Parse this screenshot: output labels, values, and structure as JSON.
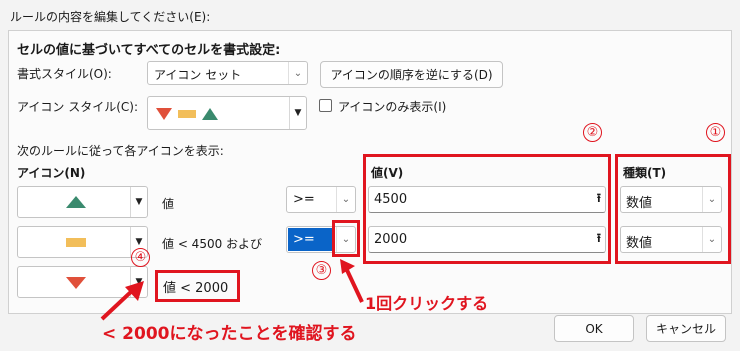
{
  "dialog": {
    "title": "ルールの内容を編集してください(E):"
  },
  "section": {
    "heading": "セルの値に基づいてすべてのセルを書式設定:"
  },
  "format_style": {
    "label": "書式スタイル(O):",
    "value": "アイコン セット"
  },
  "reverse_button": {
    "label": "アイコンの順序を逆にする(D)"
  },
  "icon_style": {
    "label": "アイコン スタイル(C):"
  },
  "show_icon_only": {
    "label": "アイコンのみ表示(I)",
    "checked": false
  },
  "rules_heading": "次のルールに従って各アイコンを表示:",
  "columns": {
    "icon": "アイコン(N)",
    "value": "値(V)",
    "type": "種類(T)"
  },
  "rules": [
    {
      "icon": "green-triangle-up-icon",
      "condition": "値",
      "operator": ">=",
      "value": "4500",
      "type": "数値"
    },
    {
      "icon": "yellow-dash-icon",
      "condition": "値 < 4500 および",
      "operator": ">=",
      "value": "2000",
      "type": "数値"
    },
    {
      "icon": "red-triangle-down-icon",
      "condition": "値 < 2000"
    }
  ],
  "annotations": {
    "num1": "①",
    "num2": "②",
    "num3": "③",
    "num4": "④",
    "click_once": "1回クリックする",
    "confirm": "< 2000になったことを確認する"
  },
  "buttons": {
    "ok": "OK",
    "cancel": "キャンセル"
  },
  "colors": {
    "accent_red": "#e0151f",
    "icon_green": "#3a8a6e",
    "icon_yellow": "#f2be5a",
    "icon_red": "#e0503a"
  }
}
